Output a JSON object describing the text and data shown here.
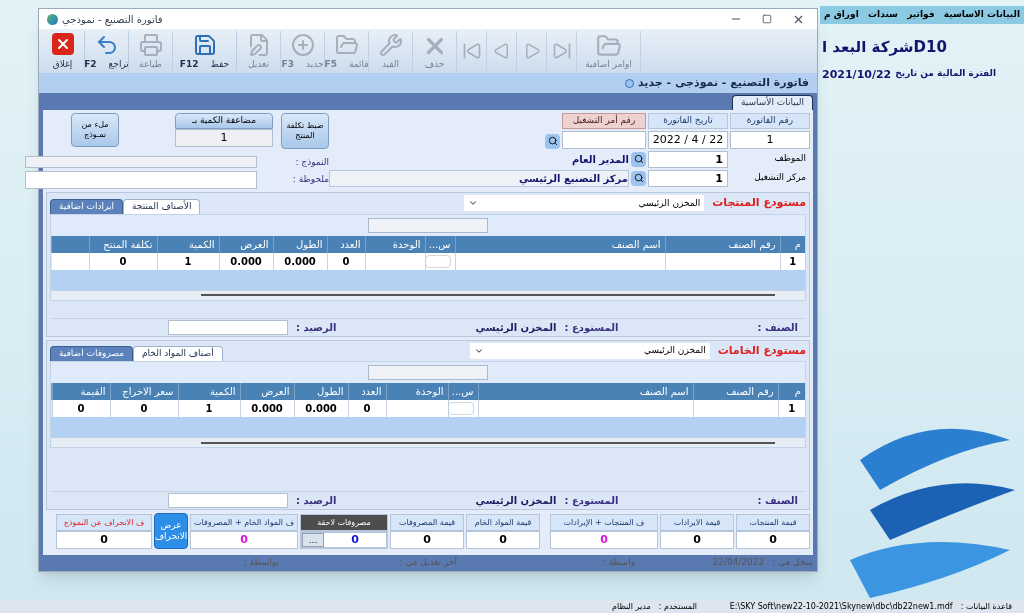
{
  "app_menu": [
    "البيانات الاساسية",
    "فواتير",
    "سندات",
    "اوراق م"
  ],
  "company": {
    "name": "D10شركة البعد ا",
    "period_label": "الفترة المالية من تاريخ",
    "period_date": "2021/10/22"
  },
  "window": {
    "title": "فاتورة التصنيع - نموذجي"
  },
  "toolbar": [
    {
      "kind": "more",
      "label": "اوامر اضافية",
      "disabled": true
    },
    {
      "kind": "last",
      "disabled": true
    },
    {
      "kind": "next",
      "disabled": true
    },
    {
      "kind": "prev",
      "disabled": true
    },
    {
      "kind": "first",
      "disabled": true
    },
    {
      "kind": "delete",
      "label": "حذف",
      "disabled": true
    },
    {
      "kind": "journal",
      "label": "القيد",
      "disabled": true
    },
    {
      "kind": "list",
      "label": "قائمة",
      "shortcut": "F5",
      "disabled": true
    },
    {
      "kind": "new",
      "label": "جديد",
      "shortcut": "F3",
      "disabled": true
    },
    {
      "kind": "edit",
      "label": "تعديل",
      "disabled": true
    },
    {
      "kind": "save",
      "label": "حفظ",
      "shortcut": "F12",
      "disabled": false
    },
    {
      "kind": "print",
      "label": "طباعة",
      "disabled": true
    },
    {
      "kind": "undo",
      "label": "تراجع",
      "shortcut": "F2",
      "disabled": false
    },
    {
      "kind": "close",
      "label": "إغلاق",
      "disabled": false
    }
  ],
  "form_title": "فاتورة التصنيع - نموذجى - جديد",
  "tabs": [
    {
      "label": "البيانات الأساسية",
      "selected": true
    }
  ],
  "header": {
    "invoice_number": {
      "label": "رقم الفاتورة",
      "value": "1"
    },
    "invoice_date": {
      "label": "تاريخ الفاتورة",
      "value": "2022 / 4 / 22"
    },
    "work_order": {
      "label": "رقم أمر التشغيل"
    },
    "employee": {
      "label": "الموظف",
      "value": "1",
      "name": "المدير العام"
    },
    "center": {
      "label": "مركز التشغيل",
      "value": "1",
      "name": "مركز التصنيع الرئيسي"
    },
    "adjust_button": "ضبط تكلفة المنتج",
    "multiply": {
      "label": "مضاعفة الكمية بـ",
      "value": "1"
    },
    "fill_button": "ملء من نمـوذج",
    "template_label": "النموذج :",
    "note_label": "ملحوظة :"
  },
  "products": {
    "warehouse_label": "مستودع المنتجات",
    "warehouse_value": "المخزن الرئيسي",
    "tabs": [
      {
        "label": "الأصناف المنتجة",
        "selected": true
      },
      {
        "label": "ايرادات اضافية",
        "selected": false
      }
    ],
    "columns": [
      "م",
      "رقم الصنف",
      "اسم الصنف",
      "س...",
      "الوحدة",
      "العدد",
      "الطول",
      "العرض",
      "الكمية",
      "تكلفة المنتج"
    ],
    "rows": [
      [
        "1",
        "",
        "",
        "",
        "",
        "0",
        "0.000",
        "0.000",
        "1",
        "0"
      ]
    ],
    "item_label": "الصنف :",
    "store_label": "المستودع :",
    "store_value": "المخزن الرئيسي",
    "balance_label": "الرصيد :"
  },
  "materials": {
    "warehouse_label": "مستودع الخامات",
    "warehouse_value": "المخزن الرئيسي",
    "tabs": [
      {
        "label": "أصناف المواد الخام",
        "selected": true
      },
      {
        "label": "مصروفات اضافية",
        "selected": false
      }
    ],
    "columns": [
      "م",
      "رقم الصنف",
      "اسم الصنف",
      "س...",
      "الوحدة",
      "العدد",
      "الطول",
      "العرض",
      "الكمية",
      "سعر الاخراج",
      "القيمة"
    ],
    "rows": [
      [
        "1",
        "",
        "",
        "",
        "",
        "0",
        "0.000",
        "0.000",
        "1",
        "0",
        "0"
      ]
    ],
    "item_label": "الصنف :",
    "store_label": "المستودع :",
    "store_value": "المخزن الرئيسي",
    "balance_label": "الرصيد :"
  },
  "totals": [
    {
      "kind": "value",
      "label": "قيمة المنتجات",
      "value": "0"
    },
    {
      "kind": "value",
      "label": "قيمة الايرادات",
      "value": "0"
    },
    {
      "kind": "sum",
      "label": "ف المنتجات + الإيرادات",
      "value": "0"
    },
    {
      "kind": "gap"
    },
    {
      "kind": "value",
      "label": "قيمة المواد الخام",
      "value": "0"
    },
    {
      "kind": "value",
      "label": "قيمة المصروفات",
      "value": "0"
    },
    {
      "kind": "later",
      "label": "مصروفات لاحقة",
      "value": "0",
      "button": "..."
    },
    {
      "kind": "sum",
      "label": "ف المواد الخام + المصروفات",
      "value": "0"
    },
    {
      "kind": "button",
      "label": "عرض الانحراف"
    },
    {
      "kind": "deviation",
      "label": "ف الانحراف عن النموذج",
      "value": "0"
    }
  ],
  "record": [
    {
      "label": "سجل في :",
      "value": "22/04/2022"
    },
    {
      "label": "واسطة :"
    },
    {
      "label": "آخر تعديل في :"
    },
    {
      "label": "بواسطة :"
    }
  ],
  "status_bar": {
    "db_label": "قاعدة البيانات :",
    "db_path": "E:\\SKY  Soft\\new22-10-2021\\Skynew\\dbc\\db22new1.mdf",
    "user_label": "المستخدم :",
    "user": "مدير النظام"
  }
}
